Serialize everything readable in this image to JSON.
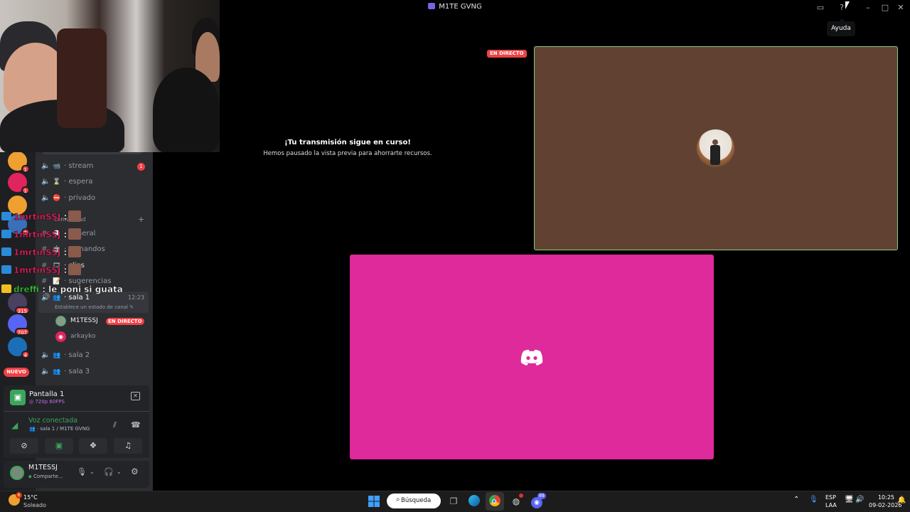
{
  "window": {
    "title": "M1TE GVNG",
    "tooltip": "Ayuda"
  },
  "webcam": {
    "description_icon": "webcam-icon"
  },
  "servers": [
    {
      "badge": "1",
      "color": "#f0a030"
    },
    {
      "badge": "1",
      "color": "#e0245e"
    },
    {
      "badge": "",
      "color": "#f0a030"
    },
    {
      "badge": "2",
      "color": "#3b6fb8"
    },
    {
      "badge": "315",
      "color": "#4a4060"
    },
    {
      "badge": "707",
      "color": "#5865f2"
    },
    {
      "badge": "4",
      "color": "#1a6fb8"
    },
    {
      "badge": "NUEVO",
      "color": "#e0245e"
    }
  ],
  "channels": {
    "stream": "stream",
    "stream_badge": "1",
    "espera": "espera",
    "privado": "privado",
    "comunidad": "comunidad",
    "general": "general",
    "comandos": "comandos",
    "clips": "clips",
    "sugerencias": "sugerencias",
    "sala1": "sala 1",
    "sala1_time": "12:23",
    "sala1_status": "Establece un estado de canal",
    "member1": "M1TESSJ",
    "member1_live": "EN DIRECTO",
    "member2": "arkayko",
    "sala2": "sala 2",
    "sala3": "sala 3"
  },
  "chat": [
    {
      "name": "1mrtinSSJ",
      "text": ":"
    },
    {
      "name": "1mrtinSSJ",
      "text": ":"
    },
    {
      "name": "1mrtinSSJ",
      "text": ":"
    },
    {
      "name": "1mrtinSSJ",
      "text": ":"
    },
    {
      "name": "dreffi",
      "text": ": le poni si guata"
    }
  ],
  "stream_panel": {
    "title": "Pantalla 1",
    "quality": "720p 60FPS"
  },
  "voice_panel": {
    "status": "Voz conectada",
    "location": "sala 1 / M1TE GVNG"
  },
  "user_panel": {
    "username": "M1TESSJ",
    "status": "Comparte..."
  },
  "stage": {
    "paused_title": "¡Tu transmisión sigue en curso!",
    "paused_subtitle": "Hemos pausado la vista previa para ahorrarte recursos.",
    "live_tag": "EN DIRECTO"
  },
  "taskbar": {
    "weather_temp": "15°C",
    "weather_desc": "Soleado",
    "weather_badge": "6",
    "search": "Búsqueda",
    "lang1": "ESP",
    "lang2": "LAA",
    "time": "10:25",
    "date": "09-02-2026",
    "discord_badge": "99"
  }
}
